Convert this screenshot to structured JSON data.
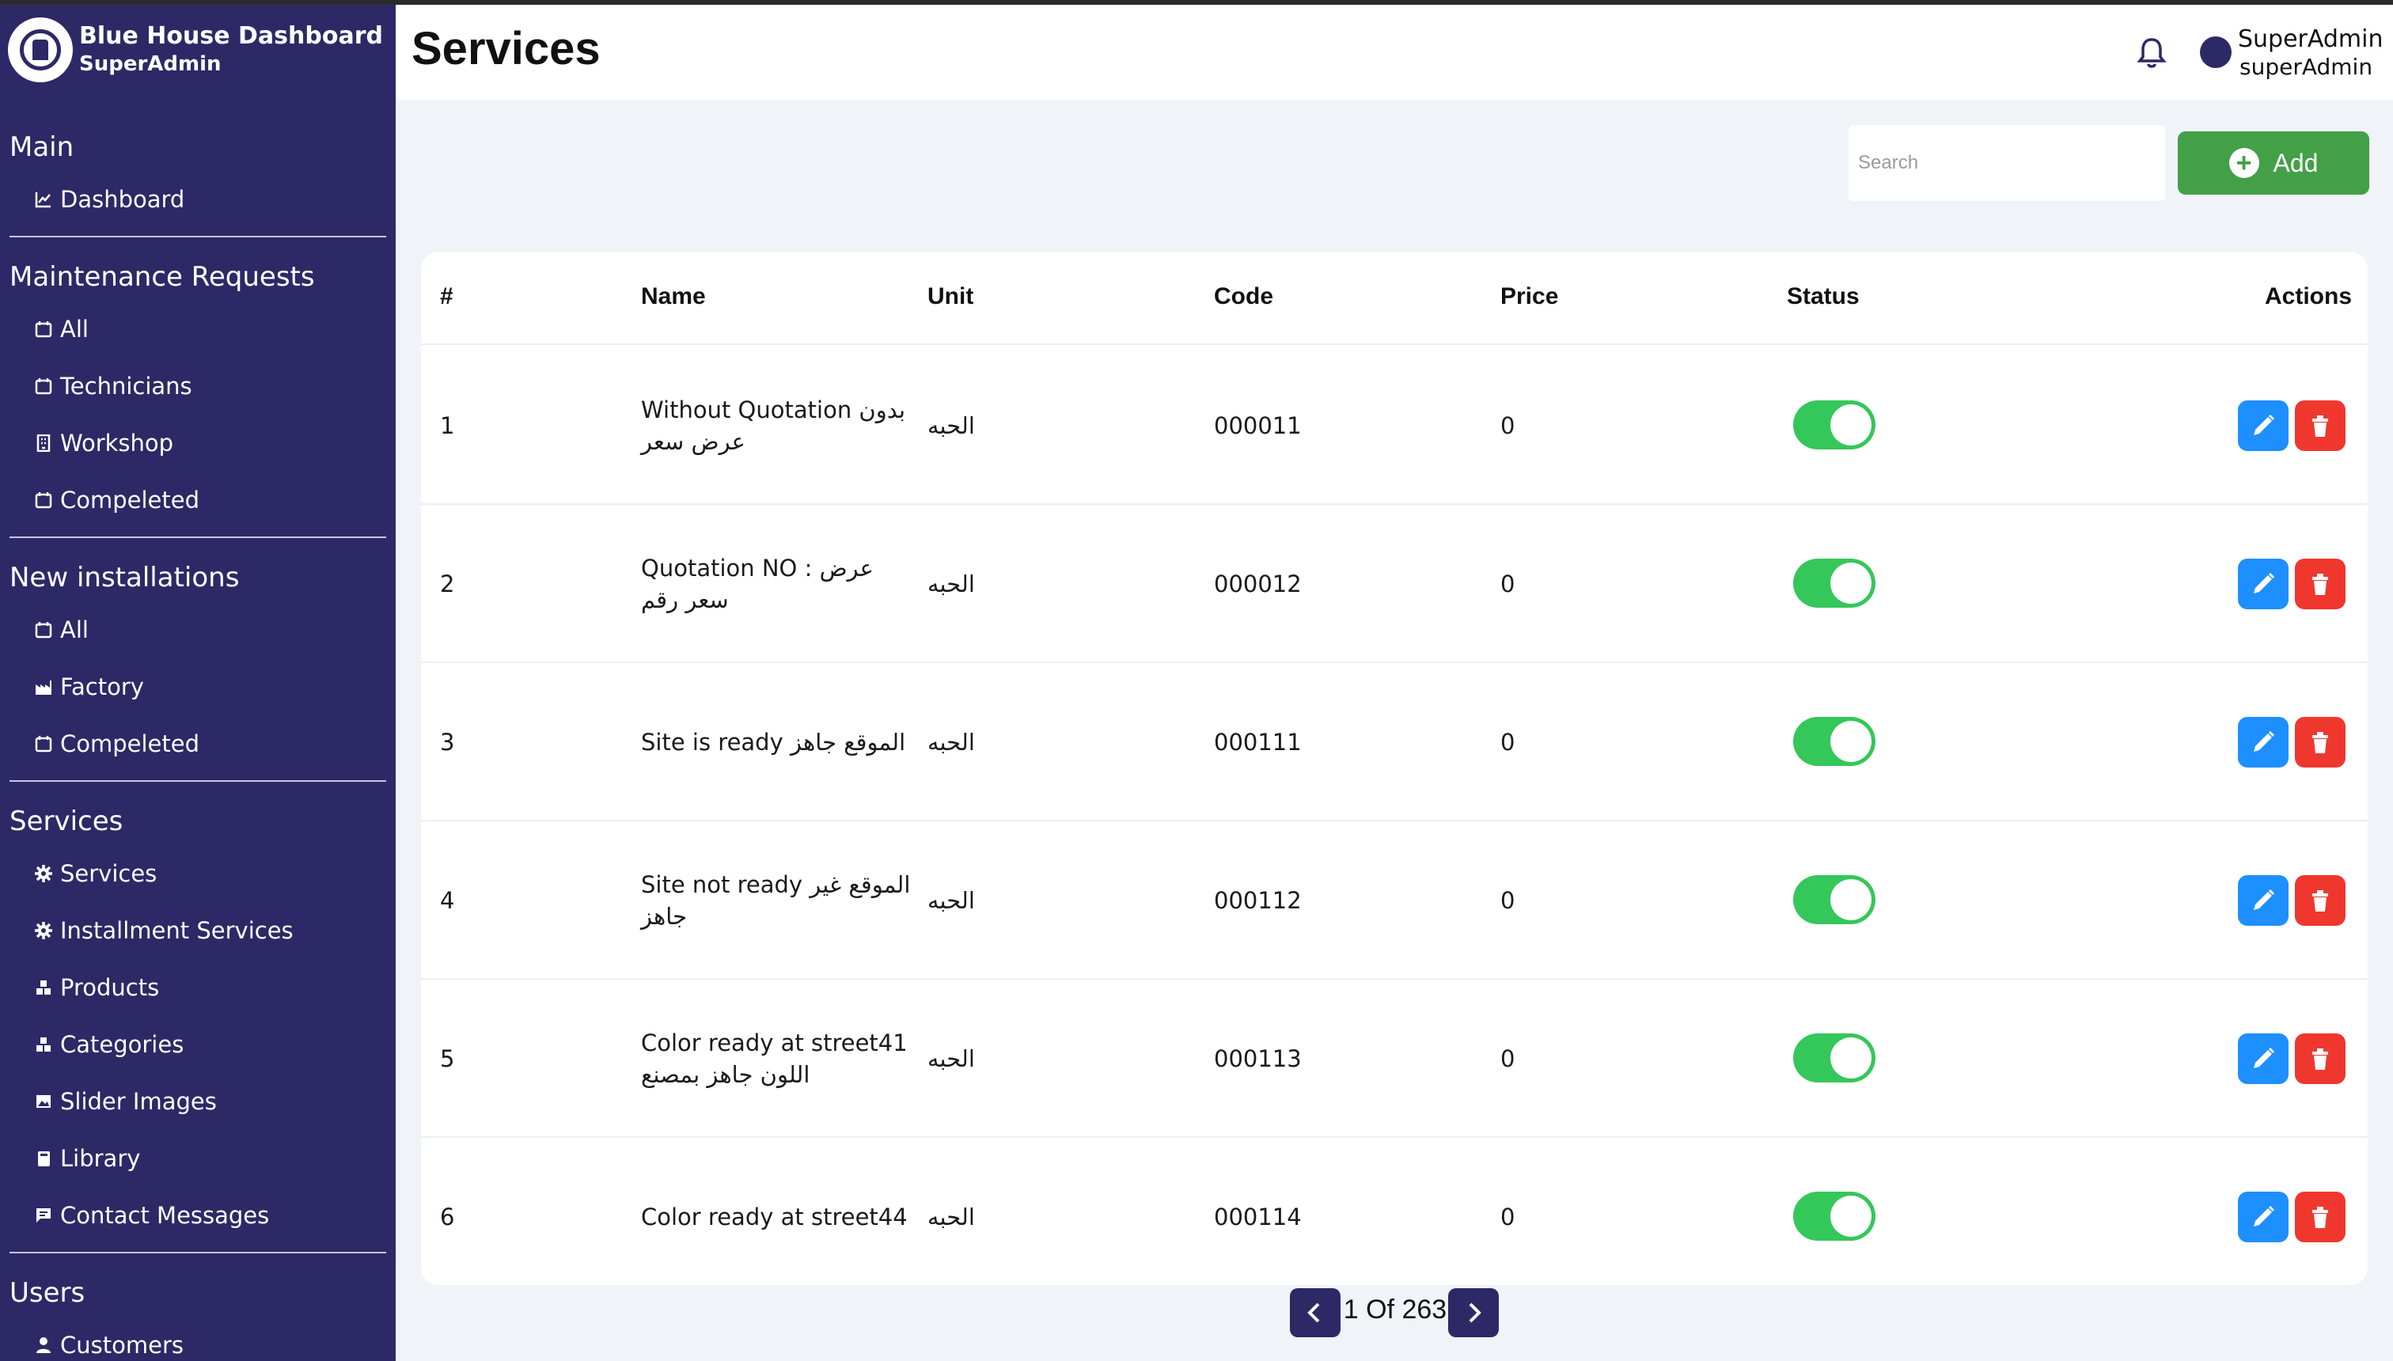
{
  "brand": {
    "title": "Blue House Dashboard",
    "subtitle": "SuperAdmin"
  },
  "sidebar": {
    "sections": [
      {
        "title": "Main",
        "items": [
          {
            "label": "Dashboard",
            "icon": "chart-line-icon"
          }
        ]
      },
      {
        "title": "Maintenance Requests",
        "items": [
          {
            "label": "All",
            "icon": "calendar-icon"
          },
          {
            "label": "Technicians",
            "icon": "calendar-icon"
          },
          {
            "label": "Workshop",
            "icon": "building-icon"
          },
          {
            "label": "Compeleted",
            "icon": "calendar-icon"
          }
        ]
      },
      {
        "title": "New installations",
        "items": [
          {
            "label": "All",
            "icon": "calendar-icon"
          },
          {
            "label": "Factory",
            "icon": "factory-icon"
          },
          {
            "label": "Compeleted",
            "icon": "calendar-icon"
          }
        ]
      },
      {
        "title": "Services",
        "items": [
          {
            "label": "Services",
            "icon": "gear-icon"
          },
          {
            "label": "Installment Services",
            "icon": "gear-icon"
          },
          {
            "label": "Products",
            "icon": "cubes-icon"
          },
          {
            "label": "Categories",
            "icon": "cubes-icon"
          },
          {
            "label": "Slider Images",
            "icon": "image-icon"
          },
          {
            "label": "Library",
            "icon": "book-icon"
          },
          {
            "label": "Contact Messages",
            "icon": "message-icon"
          }
        ]
      },
      {
        "title": "Users",
        "items": [
          {
            "label": "Customers",
            "icon": "user-icon"
          }
        ]
      }
    ]
  },
  "header": {
    "title": "Services",
    "user_name": "SuperAdmin",
    "user_role": "superAdmin"
  },
  "toolbar": {
    "search_placeholder": "Search",
    "add_label": "Add"
  },
  "table": {
    "columns": [
      "#",
      "Name",
      "Unit",
      "Code",
      "Price",
      "Status",
      "Actions"
    ],
    "rows": [
      {
        "num": "1",
        "name": " Without Quotation بدون عرض سعر",
        "unit": "الحبه",
        "code": "000011",
        "price": "0",
        "active": true
      },
      {
        "num": "2",
        "name": " Quotation NO : عرض سعر رقم",
        "unit": "الحبه",
        "code": "000012",
        "price": "0",
        "active": true
      },
      {
        "num": "3",
        "name": "Site   is   ready الموقع جاهز",
        "unit": "الحبه",
        "code": "000111",
        "price": "0",
        "active": true
      },
      {
        "num": "4",
        "name": "Site not ready الموقع غير جاهز",
        "unit": "الحبه",
        "code": "000112",
        "price": "0",
        "active": true
      },
      {
        "num": "5",
        "name": "Color ready at street41 اللون جاهز بمصنع",
        "unit": "الحبه",
        "code": "000113",
        "price": "0",
        "active": true
      },
      {
        "num": "6",
        "name": "Color ready at street44",
        "unit": "الحبه",
        "code": "000114",
        "price": "0",
        "active": true
      }
    ]
  },
  "pagination": {
    "text": "1 Of 263"
  },
  "colors": {
    "sidebar": "#2d2966",
    "add_button": "#43a047",
    "toggle_on": "#34c759",
    "edit": "#1e8fff",
    "delete": "#f0372e"
  }
}
